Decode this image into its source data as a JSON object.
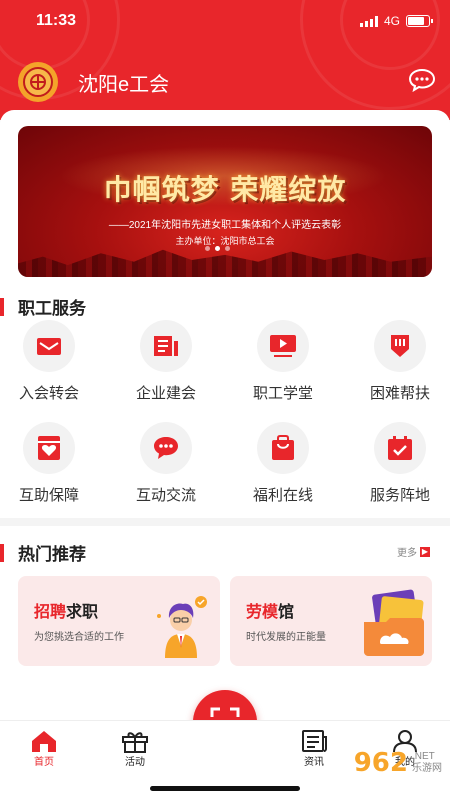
{
  "status": {
    "time": "11:33",
    "network": "4G"
  },
  "header": {
    "title": "沈阳e工会"
  },
  "banner": {
    "title": "巾帼筑梦 荣耀绽放",
    "subtitle": "——2021年沈阳市先进女职工集体和个人评选云表彰",
    "organizer": "主办单位：沈阳市总工会",
    "slides": 3,
    "active_slide": 1
  },
  "services": {
    "title": "职工服务",
    "items": [
      {
        "label": "入会转会",
        "icon": "mail-icon"
      },
      {
        "label": "企业建会",
        "icon": "document-icon"
      },
      {
        "label": "职工学堂",
        "icon": "video-icon"
      },
      {
        "label": "困难帮扶",
        "icon": "hand-support-icon"
      },
      {
        "label": "互助保障",
        "icon": "heart-shield-icon"
      },
      {
        "label": "互动交流",
        "icon": "chat-bubble-icon"
      },
      {
        "label": "福利在线",
        "icon": "gift-bag-icon"
      },
      {
        "label": "服务阵地",
        "icon": "calendar-check-icon"
      }
    ]
  },
  "recommend": {
    "title": "热门推荐",
    "more": "更多",
    "cards": [
      {
        "title_highlight": "招聘",
        "title_rest": "求职",
        "subtitle": "为您挑选合适的工作"
      },
      {
        "title_highlight": "劳模",
        "title_rest": "馆",
        "subtitle": "时代发展的正能量"
      }
    ]
  },
  "tabbar": {
    "items": [
      {
        "label": "首页",
        "active": true
      },
      {
        "label": "活动",
        "active": false
      },
      {
        "label": "资讯",
        "active": false
      },
      {
        "label": "我的",
        "active": false
      }
    ]
  },
  "watermark": {
    "number": "962",
    "text_top": ".NET",
    "text_bottom": "乐游网"
  },
  "colors": {
    "primary": "#e8262b",
    "card_bg": "#fbe9e9"
  }
}
